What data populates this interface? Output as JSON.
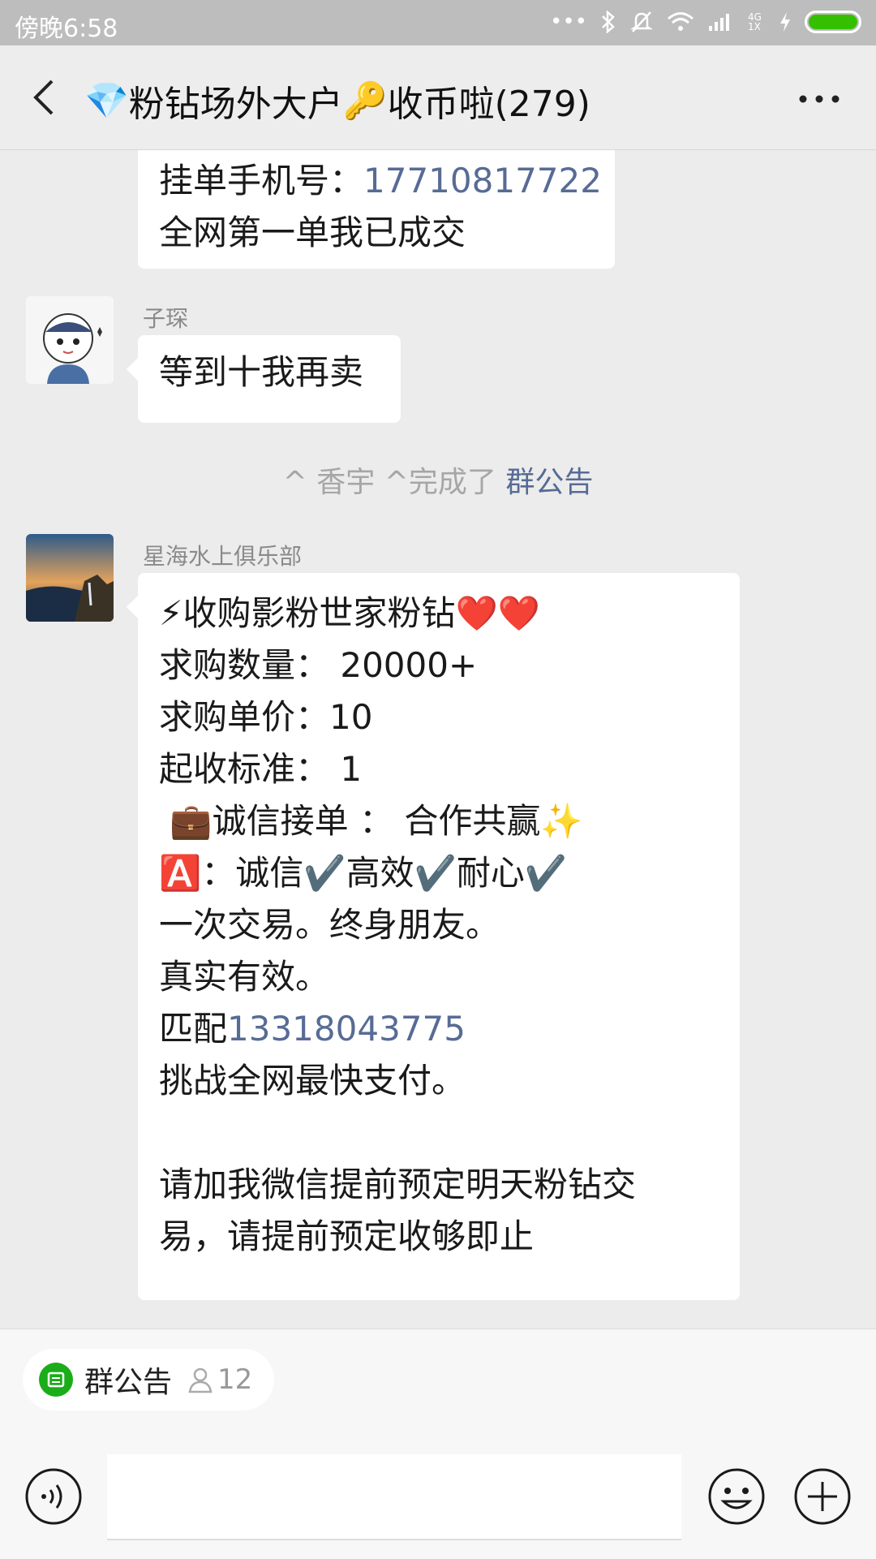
{
  "status_bar": {
    "time": "傍晚6:58",
    "signal_text": "4G\n1X",
    "icons": [
      "dots-icon",
      "bluetooth-icon",
      "mute-icon",
      "wifi-icon",
      "signal-icon",
      "charging-icon",
      "battery-icon"
    ],
    "battery_color": "#34c000"
  },
  "header": {
    "title": "粉钻场外大户",
    "title_suffix": "收币啦(279)",
    "title_emoji_1": "💎",
    "title_emoji_2": "🔑"
  },
  "messages": [
    {
      "lines": [
        "挂单手机号：",
        "全网第一单我已成交"
      ],
      "phone": "17710817722"
    },
    {
      "sender": "子琛",
      "text": "等到十我再卖"
    },
    {
      "system_text": "^ 香宇 ^完成了",
      "system_link": "群公告"
    },
    {
      "sender": "星海水上俱乐部",
      "lines": [
        "⚡收购影粉世家粉钻❤️❤️",
        "求购数量： 20000+",
        "求购单价：10",
        "起收标准： 1",
        " 💼诚信接单 ： 合作共赢✨",
        "🅰️：诚信✔️高效✔️耐心✔️",
        "一次交易。终身朋友。",
        "真实有效。",
        "匹配",
        "挑战全网最快支付。",
        "",
        "请加我微信提前预定明天粉钻交",
        "易，请提前预定收够即止"
      ],
      "phone": "13318043775"
    }
  ],
  "bottom": {
    "notice_label": "群公告",
    "notice_count": "12",
    "accent": "#1aad19"
  },
  "colors": {
    "link": "#576b95",
    "background": "#ececec"
  }
}
